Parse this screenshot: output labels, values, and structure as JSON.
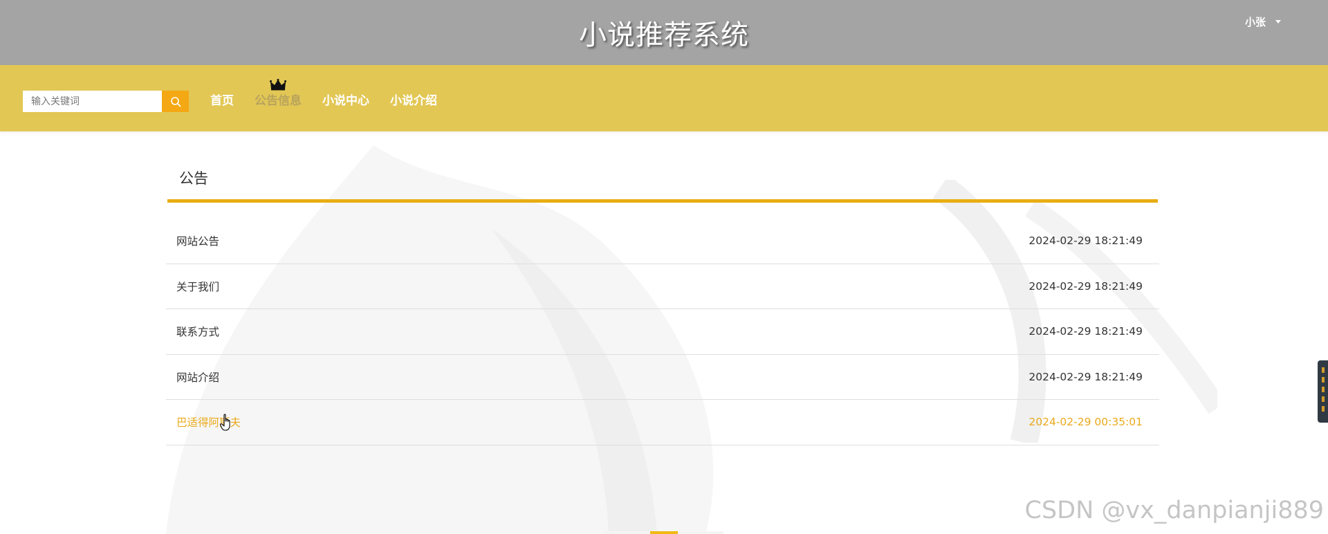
{
  "header": {
    "site_title": "小说推荐系统",
    "user_name": "小张"
  },
  "search": {
    "placeholder": "输入关键词"
  },
  "nav": {
    "items": [
      {
        "label": "首页"
      },
      {
        "label": "公告信息",
        "active": true
      },
      {
        "label": "小说中心"
      },
      {
        "label": "小说介绍"
      }
    ]
  },
  "panel": {
    "title": "公告",
    "accent_color": "#e8ae12",
    "notices": [
      {
        "title": "网站公告",
        "date": "2024-02-29 18:21:49"
      },
      {
        "title": "关于我们",
        "date": "2024-02-29 18:21:49"
      },
      {
        "title": "联系方式",
        "date": "2024-02-29 18:21:49"
      },
      {
        "title": "网站介绍",
        "date": "2024-02-29 18:21:49"
      },
      {
        "title": "巴适得阿斯夫",
        "date": "2024-02-29 00:35:01"
      }
    ]
  },
  "watermark": "CSDN @vx_danpianji889",
  "colors": {
    "header_bg": "#a4a4a4",
    "nav_bg": "#e2c755",
    "search_button": "#f4a814",
    "hover_text": "#eaa91a"
  },
  "icons": {
    "search": "search-icon",
    "crown": "crown-icon",
    "caret": "chevron-down-icon"
  }
}
